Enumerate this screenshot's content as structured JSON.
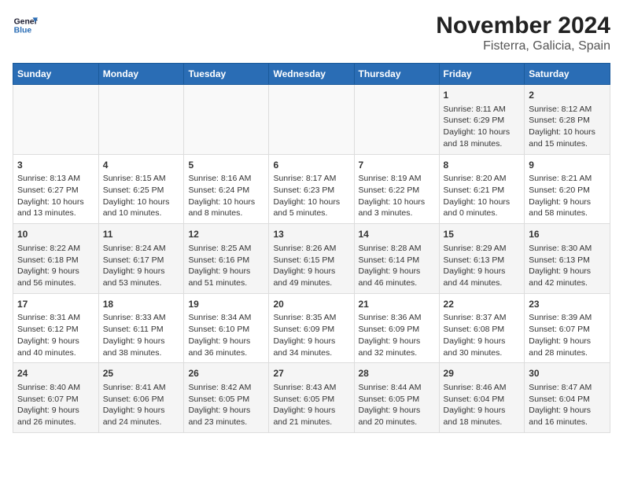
{
  "logo": {
    "line1": "General",
    "line2": "Blue"
  },
  "title": "November 2024",
  "subtitle": "Fisterra, Galicia, Spain",
  "headers": [
    "Sunday",
    "Monday",
    "Tuesday",
    "Wednesday",
    "Thursday",
    "Friday",
    "Saturday"
  ],
  "weeks": [
    [
      {
        "day": "",
        "info": ""
      },
      {
        "day": "",
        "info": ""
      },
      {
        "day": "",
        "info": ""
      },
      {
        "day": "",
        "info": ""
      },
      {
        "day": "",
        "info": ""
      },
      {
        "day": "1",
        "info": "Sunrise: 8:11 AM\nSunset: 6:29 PM\nDaylight: 10 hours and 18 minutes."
      },
      {
        "day": "2",
        "info": "Sunrise: 8:12 AM\nSunset: 6:28 PM\nDaylight: 10 hours and 15 minutes."
      }
    ],
    [
      {
        "day": "3",
        "info": "Sunrise: 8:13 AM\nSunset: 6:27 PM\nDaylight: 10 hours and 13 minutes."
      },
      {
        "day": "4",
        "info": "Sunrise: 8:15 AM\nSunset: 6:25 PM\nDaylight: 10 hours and 10 minutes."
      },
      {
        "day": "5",
        "info": "Sunrise: 8:16 AM\nSunset: 6:24 PM\nDaylight: 10 hours and 8 minutes."
      },
      {
        "day": "6",
        "info": "Sunrise: 8:17 AM\nSunset: 6:23 PM\nDaylight: 10 hours and 5 minutes."
      },
      {
        "day": "7",
        "info": "Sunrise: 8:19 AM\nSunset: 6:22 PM\nDaylight: 10 hours and 3 minutes."
      },
      {
        "day": "8",
        "info": "Sunrise: 8:20 AM\nSunset: 6:21 PM\nDaylight: 10 hours and 0 minutes."
      },
      {
        "day": "9",
        "info": "Sunrise: 8:21 AM\nSunset: 6:20 PM\nDaylight: 9 hours and 58 minutes."
      }
    ],
    [
      {
        "day": "10",
        "info": "Sunrise: 8:22 AM\nSunset: 6:18 PM\nDaylight: 9 hours and 56 minutes."
      },
      {
        "day": "11",
        "info": "Sunrise: 8:24 AM\nSunset: 6:17 PM\nDaylight: 9 hours and 53 minutes."
      },
      {
        "day": "12",
        "info": "Sunrise: 8:25 AM\nSunset: 6:16 PM\nDaylight: 9 hours and 51 minutes."
      },
      {
        "day": "13",
        "info": "Sunrise: 8:26 AM\nSunset: 6:15 PM\nDaylight: 9 hours and 49 minutes."
      },
      {
        "day": "14",
        "info": "Sunrise: 8:28 AM\nSunset: 6:14 PM\nDaylight: 9 hours and 46 minutes."
      },
      {
        "day": "15",
        "info": "Sunrise: 8:29 AM\nSunset: 6:13 PM\nDaylight: 9 hours and 44 minutes."
      },
      {
        "day": "16",
        "info": "Sunrise: 8:30 AM\nSunset: 6:13 PM\nDaylight: 9 hours and 42 minutes."
      }
    ],
    [
      {
        "day": "17",
        "info": "Sunrise: 8:31 AM\nSunset: 6:12 PM\nDaylight: 9 hours and 40 minutes."
      },
      {
        "day": "18",
        "info": "Sunrise: 8:33 AM\nSunset: 6:11 PM\nDaylight: 9 hours and 38 minutes."
      },
      {
        "day": "19",
        "info": "Sunrise: 8:34 AM\nSunset: 6:10 PM\nDaylight: 9 hours and 36 minutes."
      },
      {
        "day": "20",
        "info": "Sunrise: 8:35 AM\nSunset: 6:09 PM\nDaylight: 9 hours and 34 minutes."
      },
      {
        "day": "21",
        "info": "Sunrise: 8:36 AM\nSunset: 6:09 PM\nDaylight: 9 hours and 32 minutes."
      },
      {
        "day": "22",
        "info": "Sunrise: 8:37 AM\nSunset: 6:08 PM\nDaylight: 9 hours and 30 minutes."
      },
      {
        "day": "23",
        "info": "Sunrise: 8:39 AM\nSunset: 6:07 PM\nDaylight: 9 hours and 28 minutes."
      }
    ],
    [
      {
        "day": "24",
        "info": "Sunrise: 8:40 AM\nSunset: 6:07 PM\nDaylight: 9 hours and 26 minutes."
      },
      {
        "day": "25",
        "info": "Sunrise: 8:41 AM\nSunset: 6:06 PM\nDaylight: 9 hours and 24 minutes."
      },
      {
        "day": "26",
        "info": "Sunrise: 8:42 AM\nSunset: 6:05 PM\nDaylight: 9 hours and 23 minutes."
      },
      {
        "day": "27",
        "info": "Sunrise: 8:43 AM\nSunset: 6:05 PM\nDaylight: 9 hours and 21 minutes."
      },
      {
        "day": "28",
        "info": "Sunrise: 8:44 AM\nSunset: 6:05 PM\nDaylight: 9 hours and 20 minutes."
      },
      {
        "day": "29",
        "info": "Sunrise: 8:46 AM\nSunset: 6:04 PM\nDaylight: 9 hours and 18 minutes."
      },
      {
        "day": "30",
        "info": "Sunrise: 8:47 AM\nSunset: 6:04 PM\nDaylight: 9 hours and 16 minutes."
      }
    ]
  ]
}
